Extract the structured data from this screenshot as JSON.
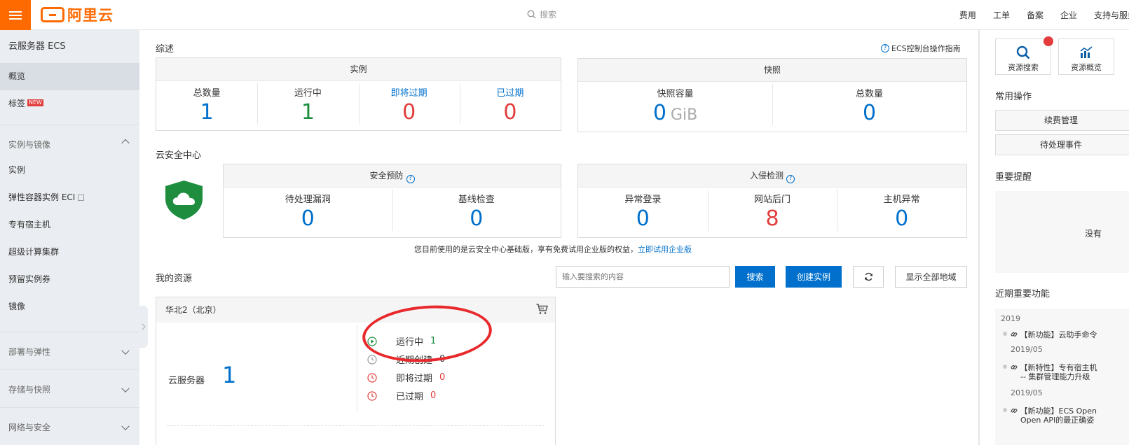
{
  "topbar": {
    "logo_text": "阿里云",
    "search_placeholder": "搜索",
    "nav": [
      "费用",
      "工单",
      "备案",
      "企业",
      "支持与服务"
    ]
  },
  "sidebar": {
    "title": "云服务器 ECS",
    "items": [
      {
        "label": "概览",
        "active": true
      },
      {
        "label": "标签",
        "badge": "NEW"
      }
    ],
    "groups": [
      {
        "label": "实例与镜像",
        "expanded": true,
        "items": [
          "实例",
          "弹性容器实例 ECI",
          "专有宿主机",
          "超级计算集群",
          "预留实例券",
          "镜像"
        ]
      },
      {
        "label": "部署与弹性"
      },
      {
        "label": "存储与快照"
      },
      {
        "label": "网络与安全"
      }
    ]
  },
  "overview": {
    "title": "综述",
    "guide_link": "ECS控制台操作指南",
    "instance_card": {
      "title": "实例",
      "stats": [
        {
          "label": "总数量",
          "value": "1"
        },
        {
          "label": "运行中",
          "value": "1"
        },
        {
          "label": "即将过期",
          "value": "0"
        },
        {
          "label": "已过期",
          "value": "0"
        }
      ]
    },
    "snapshot_card": {
      "title": "快照",
      "stats": [
        {
          "label": "快照容量",
          "value": "0",
          "unit": "GiB"
        },
        {
          "label": "总数量",
          "value": "0"
        }
      ]
    }
  },
  "security": {
    "title": "云安全中心",
    "prevention": {
      "title": "安全预防",
      "stats": [
        {
          "label": "待处理漏洞",
          "value": "0"
        },
        {
          "label": "基线检查",
          "value": "0"
        }
      ]
    },
    "intrusion": {
      "title": "入侵检测",
      "stats": [
        {
          "label": "异常登录",
          "value": "0"
        },
        {
          "label": "网站后门",
          "value": "8"
        },
        {
          "label": "主机异常",
          "value": "0"
        }
      ]
    },
    "notice_text": "您目前使用的是云安全中心基础版，享有免费试用企业版的权益，",
    "notice_link": "立即试用企业版"
  },
  "resources": {
    "title": "我的资源",
    "search_placeholder": "输入要搜索的内容",
    "search_button": "搜索",
    "create_button": "创建实例",
    "show_all_button": "显示全部地域",
    "region": {
      "name": "华北2（北京）",
      "server_label": "云服务器",
      "server_count": "1",
      "statuses": [
        {
          "label": "运行中",
          "value": "1"
        },
        {
          "label": "近期创建",
          "value": "0"
        },
        {
          "label": "即将过期",
          "value": "0"
        },
        {
          "label": "已过期",
          "value": "0"
        }
      ]
    }
  },
  "right_panel": {
    "tiles": [
      "资源搜索",
      "资源概览"
    ],
    "common_ops_title": "常用操作",
    "common_ops": [
      "续费管理",
      "待处理事件"
    ],
    "alerts_title": "重要提醒",
    "alerts_empty": "没有",
    "features_title": "近期重要功能",
    "features": [
      {
        "year": "2019",
        "title": "【新功能】云助手命令",
        "date": "2019/05"
      },
      {
        "title": "【新特性】专有宿主机",
        "title2": "-- 集群管理能力升级",
        "date": "2019/05"
      },
      {
        "title": "【新功能】ECS Open",
        "title2": "Open API的最正确姿"
      }
    ]
  },
  "colors": {
    "brand": "#ff6a00",
    "link_blue": "#0070cc",
    "running_green": "#1e8e3e",
    "alert_red": "#e23c3c",
    "annotation_red": "#e8282b"
  }
}
